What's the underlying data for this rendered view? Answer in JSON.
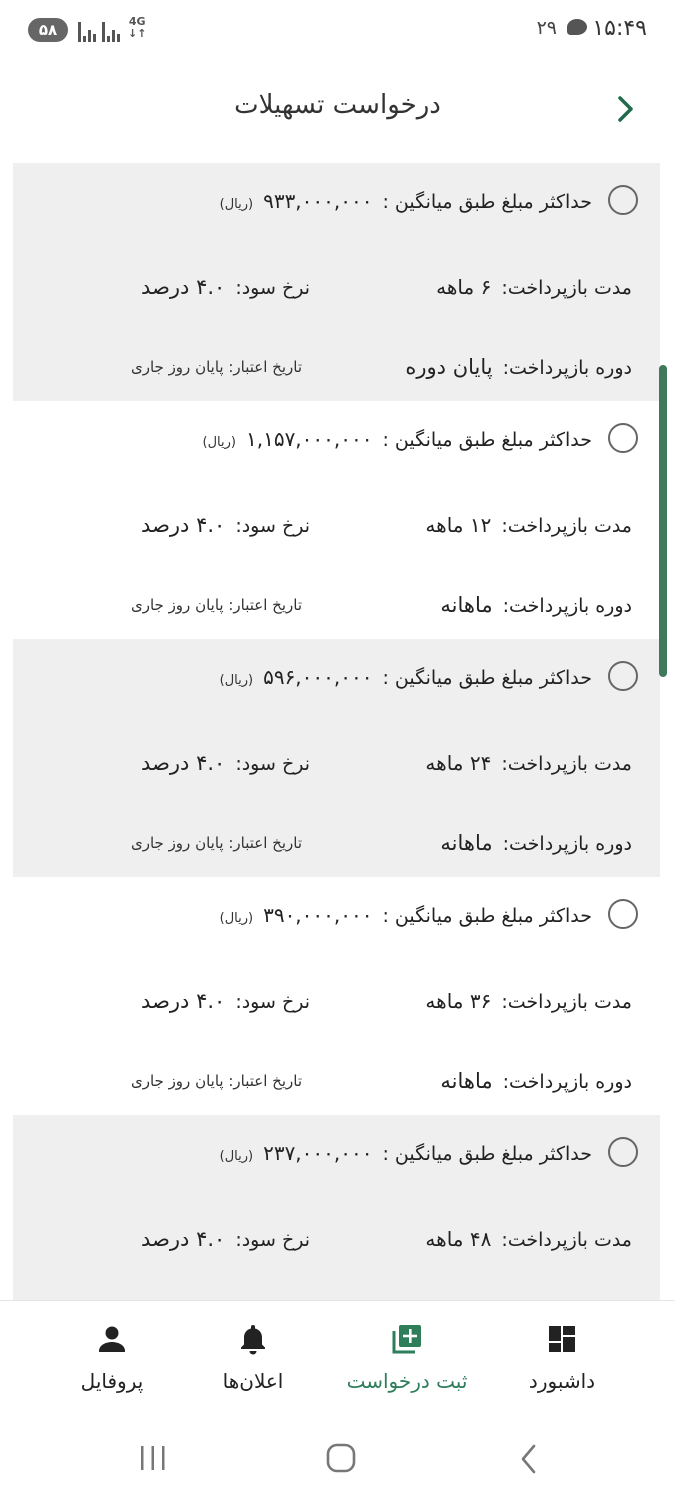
{
  "status_bar": {
    "time": "۱۵:۴۹",
    "notification_count": "۲۹",
    "battery": "۵۸",
    "network": "4G"
  },
  "header": {
    "title": "درخواست تسهیلات"
  },
  "offers": [
    {
      "max_amount_label": "حداکثر مبلغ طبق میانگین :",
      "amount": "۹۳۳,۰۰۰,۰۰۰",
      "unit": "(ریال)",
      "term_label": "مدت بازپرداخت:",
      "term": "۶ ماهه",
      "rate_label": "نرخ سود:",
      "rate": "۴.۰ درصد",
      "period_label": "دوره بازپرداخت:",
      "period": "پایان دوره",
      "validity": "تاریخ اعتبار: پایان روز جاری"
    },
    {
      "max_amount_label": "حداکثر مبلغ طبق میانگین :",
      "amount": "۱,۱۵۷,۰۰۰,۰۰۰",
      "unit": "(ریال)",
      "term_label": "مدت بازپرداخت:",
      "term": "۱۲ ماهه",
      "rate_label": "نرخ سود:",
      "rate": "۴.۰ درصد",
      "period_label": "دوره بازپرداخت:",
      "period": "ماهانه",
      "validity": "تاریخ اعتبار: پایان روز جاری"
    },
    {
      "max_amount_label": "حداکثر مبلغ طبق میانگین :",
      "amount": "۵۹۶,۰۰۰,۰۰۰",
      "unit": "(ریال)",
      "term_label": "مدت بازپرداخت:",
      "term": "۲۴ ماهه",
      "rate_label": "نرخ سود:",
      "rate": "۴.۰ درصد",
      "period_label": "دوره بازپرداخت:",
      "period": "ماهانه",
      "validity": "تاریخ اعتبار: پایان روز جاری"
    },
    {
      "max_amount_label": "حداکثر مبلغ طبق میانگین :",
      "amount": "۳۹۰,۰۰۰,۰۰۰",
      "unit": "(ریال)",
      "term_label": "مدت بازپرداخت:",
      "term": "۳۶ ماهه",
      "rate_label": "نرخ سود:",
      "rate": "۴.۰ درصد",
      "period_label": "دوره بازپرداخت:",
      "period": "ماهانه",
      "validity": "تاریخ اعتبار: پایان روز جاری"
    },
    {
      "max_amount_label": "حداکثر مبلغ طبق میانگین :",
      "amount": "۲۳۷,۰۰۰,۰۰۰",
      "unit": "(ریال)",
      "term_label": "مدت بازپرداخت:",
      "term": "۴۸ ماهه",
      "rate_label": "نرخ سود:",
      "rate": "۴.۰ درصد",
      "period_label": "",
      "period": "",
      "validity": ""
    }
  ],
  "bottom_nav": {
    "dashboard": "داشبورد",
    "new_request": "ثبت درخواست",
    "announcements": "اعلان‌ها",
    "profile": "پروفایل"
  },
  "colors": {
    "accent": "#2e7d5b",
    "card_alt": "#efefef"
  }
}
